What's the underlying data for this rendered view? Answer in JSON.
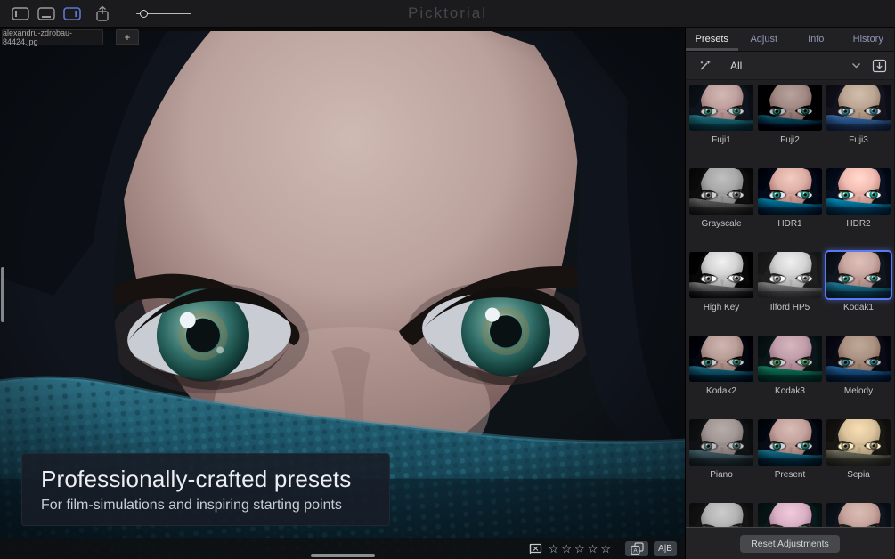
{
  "app": {
    "title": "Picktorial"
  },
  "toolbar": {
    "panel_toggles": [
      {
        "name": "left-panel",
        "active": false
      },
      {
        "name": "bottom-panel",
        "active": false
      },
      {
        "name": "right-panel",
        "active": true
      }
    ],
    "zoom_slider_percent": 13
  },
  "tabs": {
    "document_tab": "alexandru-zdrobau-84424.jpg",
    "new_tab": "+"
  },
  "photo": {
    "caption_title": "Professionally-crafted presets",
    "caption_subtitle": "For film-simulations and inspiring starting points"
  },
  "photo_bar": {
    "rating": {
      "value": 0,
      "max": 5,
      "star_glyph": "☆"
    },
    "compare_label": "A|B"
  },
  "sidebar": {
    "tabs": [
      {
        "label": "Presets",
        "active": true
      },
      {
        "label": "Adjust",
        "active": false
      },
      {
        "label": "Info",
        "active": false
      },
      {
        "label": "History",
        "active": false
      }
    ],
    "filter_selected": "All",
    "presets": [
      {
        "name": "Fuji1",
        "css": "filter:hue-rotate(-6deg) saturate(1.15)"
      },
      {
        "name": "Fuji2",
        "css": "filter:contrast(1.3) brightness(0.8) saturate(0.95)"
      },
      {
        "name": "Fuji3",
        "css": "filter:hue-rotate(24deg) saturate(1.25) brightness(1.02)"
      },
      {
        "name": "Grayscale",
        "css": "filter:grayscale(1) contrast(1.05)"
      },
      {
        "name": "HDR1",
        "css": "filter:saturate(1.55) contrast(1.1) brightness(1.08)"
      },
      {
        "name": "HDR2",
        "css": "filter:saturate(1.65) contrast(1.05) brightness(1.18)"
      },
      {
        "name": "High Key",
        "css": "filter:grayscale(1) brightness(1.2) contrast(1.15)"
      },
      {
        "name": "Ilford HP5",
        "css": "filter:grayscale(1) brightness(1.3) contrast(0.95)"
      },
      {
        "name": "Kodak1",
        "css": "filter:saturate(1.25) brightness(1.05)",
        "selected": true
      },
      {
        "name": "Kodak2",
        "css": "filter:saturate(1.05) contrast(1.12) brightness(0.95)"
      },
      {
        "name": "Kodak3",
        "css": "filter:hue-rotate(-35deg) saturate(1.2)"
      },
      {
        "name": "Melody",
        "css": "filter:hue-rotate(18deg) saturate(1.35) brightness(0.9) contrast(1.05)"
      },
      {
        "name": "Piano",
        "css": "filter:saturate(0.45) brightness(0.92)"
      },
      {
        "name": "Present",
        "css": "filter:saturate(1.2) contrast(1.08)"
      },
      {
        "name": "Sepia",
        "css": "filter:sepia(0.85) brightness(1.0)"
      }
    ],
    "partial_presets": [
      {
        "css": "filter:grayscale(1) brightness(1.08)"
      },
      {
        "css": "filter:hue-rotate(-45deg) saturate(1.3) brightness(1.12)"
      },
      {
        "css": "filter:saturate(1.3) brightness(1.03)"
      }
    ],
    "reset_button": "Reset Adjustments"
  },
  "colors": {
    "accent_blue": "#5b74d4",
    "toolbar_bg": "#1b1b1d",
    "sidebar_bg": "#212124",
    "scarf_teal": "#1d5264"
  }
}
